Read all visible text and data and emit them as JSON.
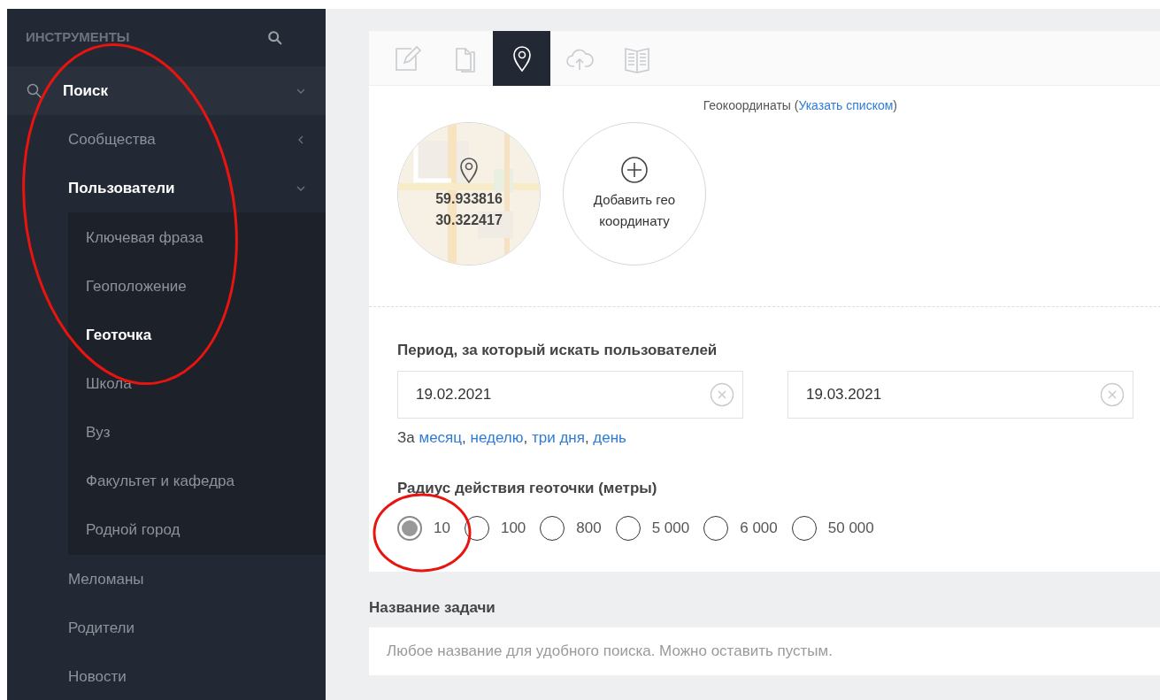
{
  "sidebar": {
    "header": "ИНСТРУМЕНТЫ",
    "items": [
      {
        "label": "Поиск",
        "expanded": true,
        "selected": false,
        "children": [
          {
            "label": "Сообщества",
            "expanded": false,
            "selected": false
          },
          {
            "label": "Пользователи",
            "expanded": true,
            "selected": false,
            "children": [
              {
                "label": "Ключевая фраза",
                "selected": false
              },
              {
                "label": "Геоположение",
                "selected": false
              },
              {
                "label": "Геоточка",
                "selected": true
              },
              {
                "label": "Школа",
                "selected": false
              },
              {
                "label": "Вуз",
                "selected": false
              },
              {
                "label": "Факультет и кафедра",
                "selected": false
              },
              {
                "label": "Родной город",
                "selected": false
              }
            ]
          },
          {
            "label": "Меломаны",
            "selected": false
          },
          {
            "label": "Родители",
            "selected": false
          },
          {
            "label": "Новости",
            "selected": false
          }
        ]
      }
    ]
  },
  "tabs": [
    {
      "kind": "edit",
      "selected": false
    },
    {
      "kind": "copy",
      "selected": false
    },
    {
      "kind": "pin",
      "selected": true
    },
    {
      "kind": "upload",
      "selected": false
    },
    {
      "kind": "book",
      "selected": false
    }
  ],
  "geo": {
    "prefix": "Геокоординаты (",
    "link": "Указать списком",
    "suffix": ")",
    "points": [
      {
        "kind": "point",
        "lines": [
          "59.933816",
          "30.322417"
        ]
      },
      {
        "kind": "add",
        "lines": [
          "Добавить гео",
          "координату"
        ]
      }
    ]
  },
  "period": {
    "label": "Период, за который искать пользователей",
    "dates": [
      {
        "value": "19.02.2021"
      },
      {
        "value": "19.03.2021"
      }
    ],
    "quick_prefix": "За",
    "quick_separator": ",",
    "quick_links": [
      "месяц",
      "неделю",
      "три дня",
      "день"
    ]
  },
  "radius": {
    "label": "Радиус действия геоточки (метры)",
    "options": [
      {
        "label": "10",
        "selected": true
      },
      {
        "label": "100",
        "selected": false
      },
      {
        "label": "800",
        "selected": false
      },
      {
        "label": "5 000",
        "selected": false
      },
      {
        "label": "6 000",
        "selected": false
      },
      {
        "label": "50 000",
        "selected": false
      }
    ]
  },
  "task_name": {
    "label": "Название задачи",
    "placeholder": "Любое название для удобного поиска. Можно оставить пустым."
  }
}
